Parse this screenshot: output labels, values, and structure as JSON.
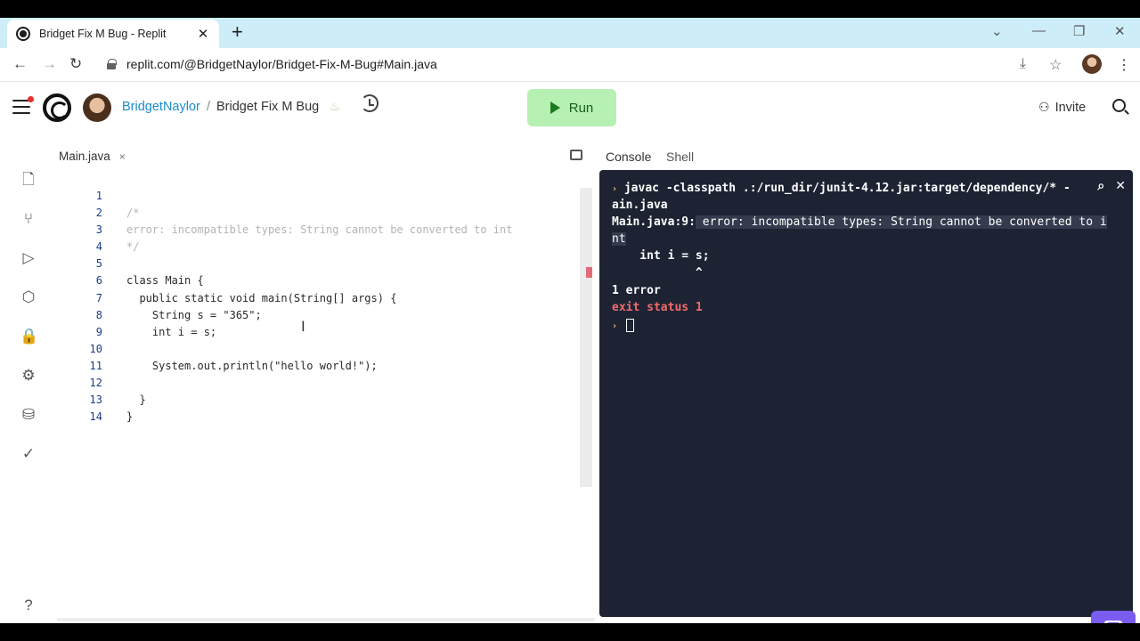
{
  "browser": {
    "tab_title": "Bridget Fix M Bug - Replit",
    "url": "replit.com/@BridgetNaylor/Bridget-Fix-M-Bug#Main.java"
  },
  "header": {
    "username": "BridgetNaylor",
    "separator": "/",
    "repl_name": "Bridget Fix M Bug",
    "run_label": "Run",
    "invite_label": "Invite"
  },
  "editor": {
    "file_tab": "Main.java",
    "lines": [
      {
        "n": "1",
        "text": ""
      },
      {
        "n": "2",
        "text": "/*"
      },
      {
        "n": "3",
        "text": "error: incompatible types: String cannot be converted to int"
      },
      {
        "n": "4",
        "text": "*/"
      },
      {
        "n": "5",
        "text": ""
      },
      {
        "n": "6",
        "text": "class Main {"
      },
      {
        "n": "7",
        "text": "  public static void main(String[] args) {"
      },
      {
        "n": "8",
        "text": "    String s = \"365\";"
      },
      {
        "n": "9",
        "text": "    int i = s;"
      },
      {
        "n": "10",
        "text": ""
      },
      {
        "n": "11",
        "text": "    System.out.println(\"hello world!\");"
      },
      {
        "n": "12",
        "text": ""
      },
      {
        "n": "13",
        "text": "  }"
      },
      {
        "n": "14",
        "text": "}"
      }
    ]
  },
  "console": {
    "tabs": [
      "Console",
      "Shell"
    ],
    "command": "javac -classpath .:/run_dir/junit-4.12.jar:target/dependency/* -",
    "command_wrap": "ain.java",
    "error_prefix": "Main.java:9:",
    "error_msg": " error: incompatible types: String cannot be converted to i",
    "error_wrap": "nt",
    "code_line": "    int i = s;",
    "caret_line": "            ^",
    "error_count": "1 error",
    "exit_status": "exit status 1"
  },
  "colors": {
    "run_bg": "#b6f0b3",
    "terminal_bg": "#1d2333",
    "exit_red": "#f26b6b",
    "link_blue": "#1b8dc9"
  }
}
